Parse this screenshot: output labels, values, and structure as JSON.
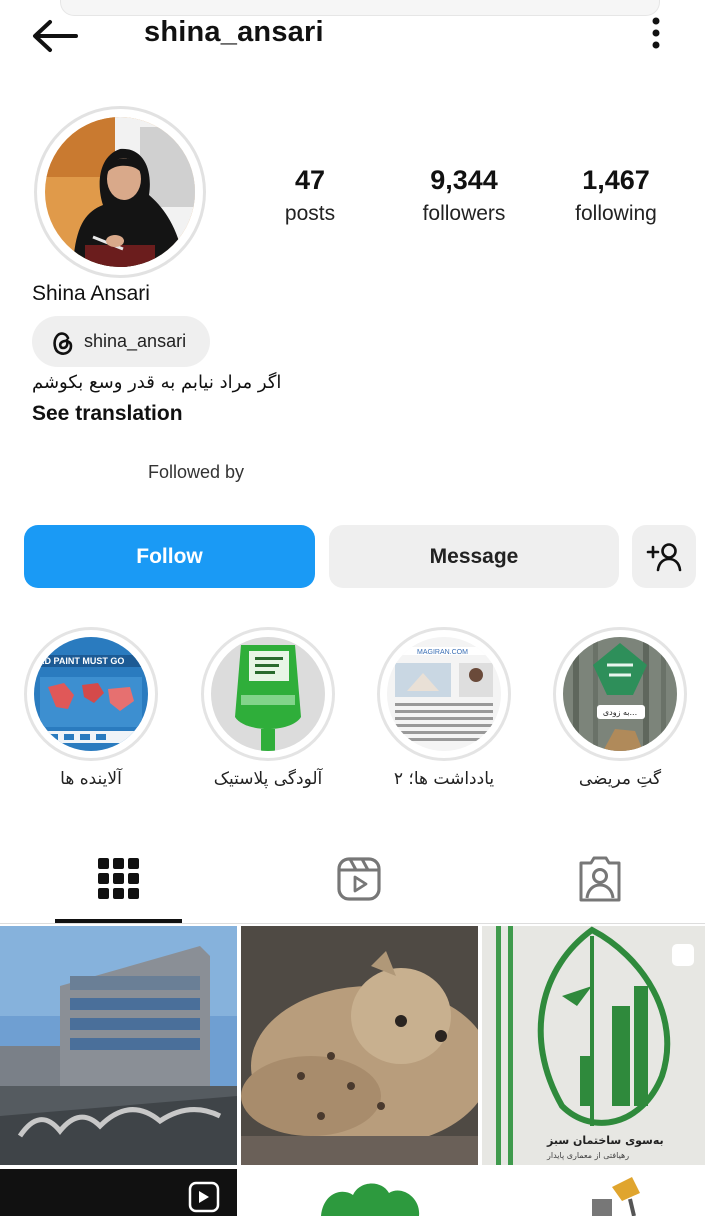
{
  "header": {
    "username": "shina_ansari",
    "back_icon": "arrow-left-icon",
    "more_icon": "more-vertical-icon"
  },
  "profile": {
    "display_name": "Shina Ansari",
    "threads_handle": "shina_ansari",
    "bio": "اگر مراد نیابم به قدر وسع بکوشم",
    "see_translation": "See translation",
    "followed_by": "Followed by",
    "stats": {
      "posts": {
        "value": "47",
        "label": "posts"
      },
      "followers": {
        "value": "9,344",
        "label": "followers"
      },
      "following": {
        "value": "1,467",
        "label": "following"
      }
    }
  },
  "actions": {
    "follow": "Follow",
    "message": "Message",
    "add_user_icon": "person-add-icon"
  },
  "highlights": [
    {
      "label": "آلاینده ها",
      "image_text": "AD PAINT MUST GO"
    },
    {
      "label": "آلودگی پلاستیک"
    },
    {
      "label": "یادداشت ها؛ ۲",
      "image_text": "MAGIRAN.COM"
    },
    {
      "label": "گتِ مریضی",
      "image_text": "به زودی..."
    }
  ],
  "tabs": [
    {
      "name": "posts-grid",
      "icon": "grid-icon",
      "active": true
    },
    {
      "name": "reels",
      "icon": "reels-icon",
      "active": false
    },
    {
      "name": "tagged",
      "icon": "tagged-person-icon",
      "active": false
    }
  ],
  "posts": [
    {
      "kind": "building"
    },
    {
      "kind": "cheetah"
    },
    {
      "kind": "green-building",
      "caption": "به‌سوی ساختمان سبز",
      "subcaption": "رهیافتی از معماری پایدار"
    },
    {
      "kind": "reel"
    },
    {
      "kind": "tree"
    },
    {
      "kind": "item"
    }
  ],
  "colors": {
    "follow_blue": "#1a9af5",
    "button_gray": "#efefef",
    "text": "#111111"
  }
}
